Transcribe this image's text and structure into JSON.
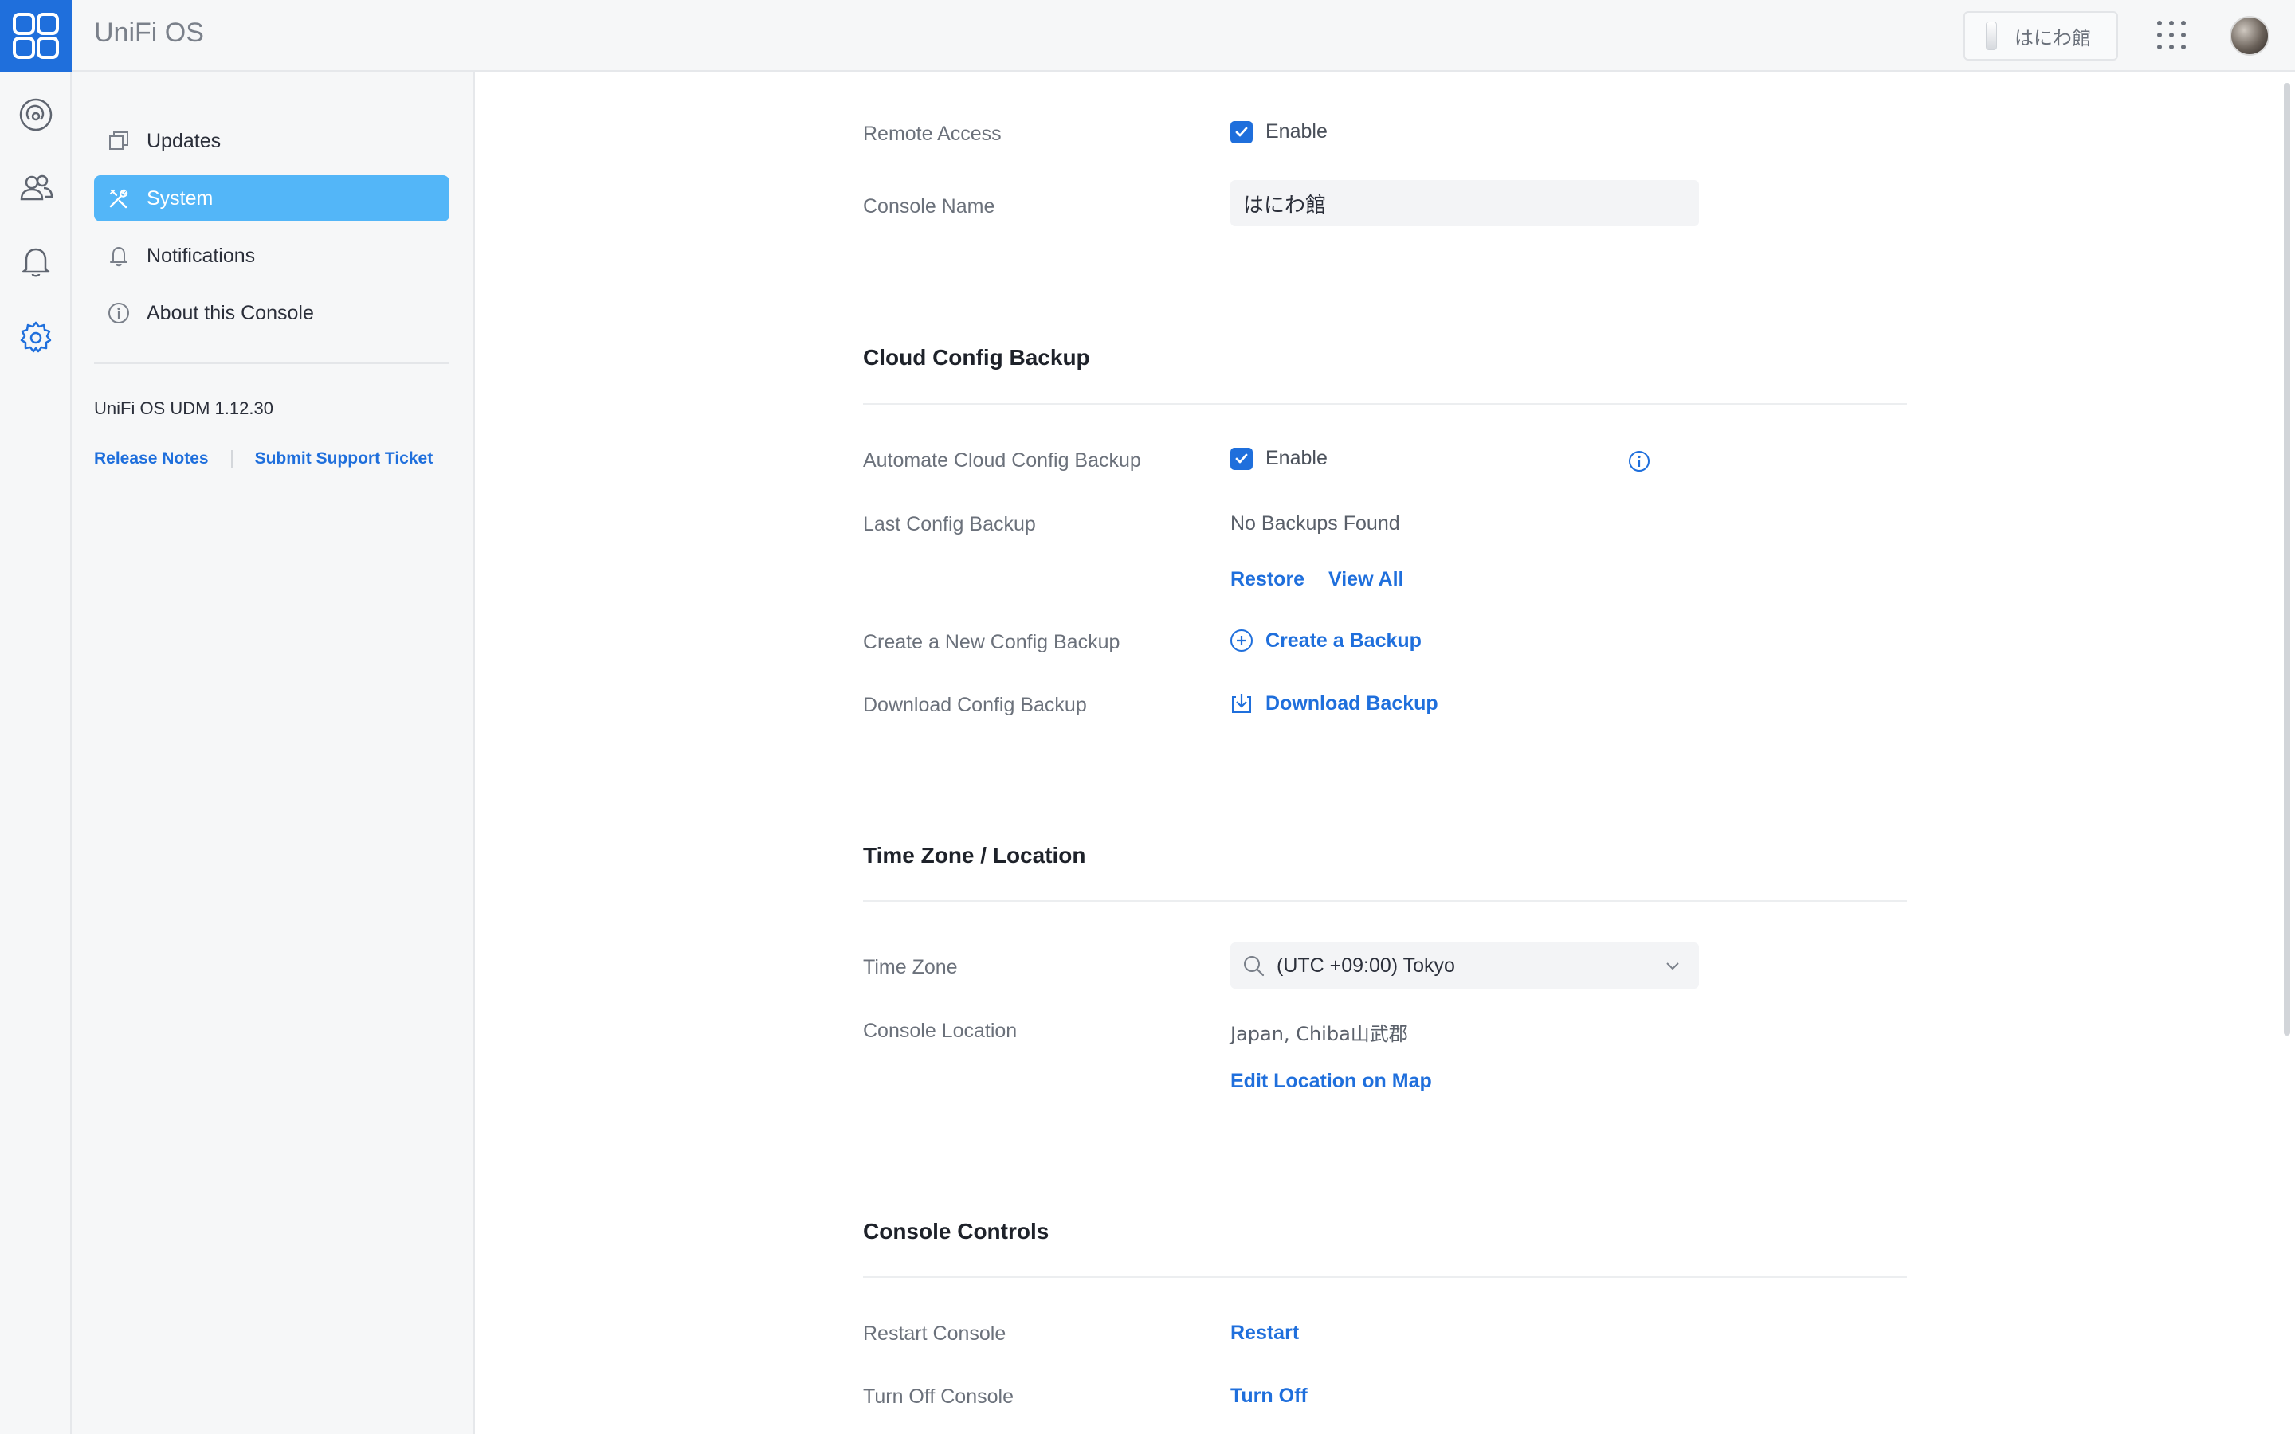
{
  "app": {
    "title": "UniFi OS"
  },
  "topbar": {
    "console_name": "はにわ館"
  },
  "menu": {
    "items": [
      {
        "label": "Updates",
        "icon": "updates-icon"
      },
      {
        "label": "System",
        "icon": "tools-icon",
        "active": true
      },
      {
        "label": "Notifications",
        "icon": "bell-icon"
      },
      {
        "label": "About this Console",
        "icon": "info-icon"
      }
    ],
    "version": "UniFi OS UDM 1.12.30",
    "links": {
      "release_notes": "Release Notes",
      "support": "Submit Support Ticket"
    }
  },
  "remote_access": {
    "label": "Remote Access",
    "checkbox_label": "Enable",
    "checked": true
  },
  "console_name": {
    "label": "Console Name",
    "value": "はにわ館"
  },
  "cloud_backup": {
    "title": "Cloud Config Backup",
    "automate_label": "Automate Cloud Config Backup",
    "automate_checkbox": "Enable",
    "last_label": "Last Config Backup",
    "last_value": "No Backups Found",
    "restore": "Restore",
    "view_all": "View All",
    "create_label": "Create a New Config Backup",
    "create_link": "Create a Backup",
    "download_label": "Download Config Backup",
    "download_link": "Download Backup"
  },
  "timezone": {
    "title": "Time Zone / Location",
    "tz_label": "Time Zone",
    "tz_value": "(UTC +09:00) Tokyo",
    "location_label": "Console Location",
    "location_value": "Japan, Chiba山武郡",
    "edit_link": "Edit Location on Map"
  },
  "controls": {
    "title": "Console Controls",
    "restart_label": "Restart Console",
    "restart_link": "Restart",
    "off_label": "Turn Off Console",
    "off_link": "Turn Off"
  },
  "colors": {
    "accent": "#1f6fdc",
    "active_menu": "#53b6f8",
    "sidebar_bg": "#f6f7f8"
  }
}
